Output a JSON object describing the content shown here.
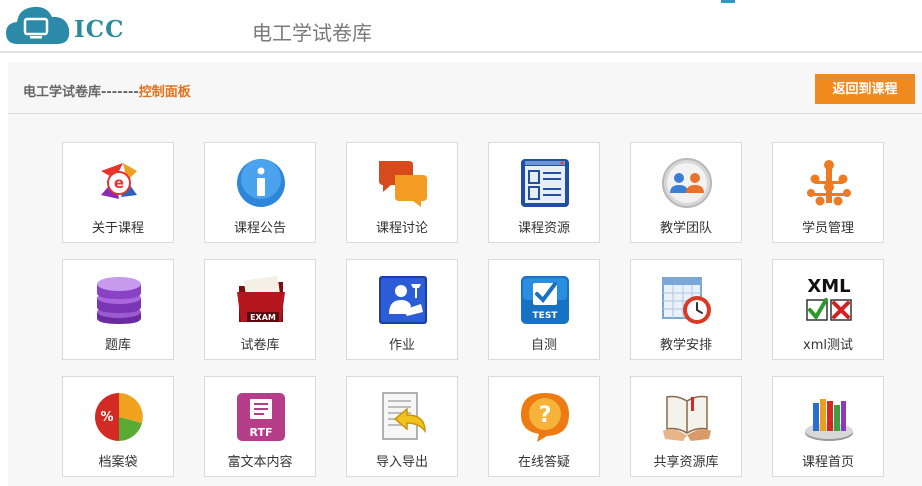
{
  "header": {
    "logo_text": "ICC",
    "site_title": "电工学试卷库"
  },
  "breadcrumb": {
    "path": "电工学试卷库-------",
    "current": "控制面板"
  },
  "back_button": "返回到课程",
  "tiles": [
    {
      "label": "关于课程",
      "icon": "course-logo-icon"
    },
    {
      "label": "课程公告",
      "icon": "info-icon"
    },
    {
      "label": "课程讨论",
      "icon": "chat-bubbles-icon"
    },
    {
      "label": "课程资源",
      "icon": "document-list-icon"
    },
    {
      "label": "教学团队",
      "icon": "team-icon"
    },
    {
      "label": "学员管理",
      "icon": "org-tree-icon"
    },
    {
      "label": "题库",
      "icon": "database-icon"
    },
    {
      "label": "试卷库",
      "icon": "exam-folder-icon"
    },
    {
      "label": "作业",
      "icon": "reading-student-icon"
    },
    {
      "label": "自测",
      "icon": "test-checkbox-icon"
    },
    {
      "label": "教学安排",
      "icon": "schedule-clock-icon"
    },
    {
      "label": "xml测试",
      "icon": "xml-check-icon"
    },
    {
      "label": "档案袋",
      "icon": "pie-chart-icon"
    },
    {
      "label": "富文本内容",
      "icon": "rtf-file-icon"
    },
    {
      "label": "导入导出",
      "icon": "import-export-icon"
    },
    {
      "label": "在线答疑",
      "icon": "question-bubble-icon"
    },
    {
      "label": "共享资源库",
      "icon": "shared-book-icon"
    },
    {
      "label": "课程首页",
      "icon": "home-books-icon"
    }
  ]
}
